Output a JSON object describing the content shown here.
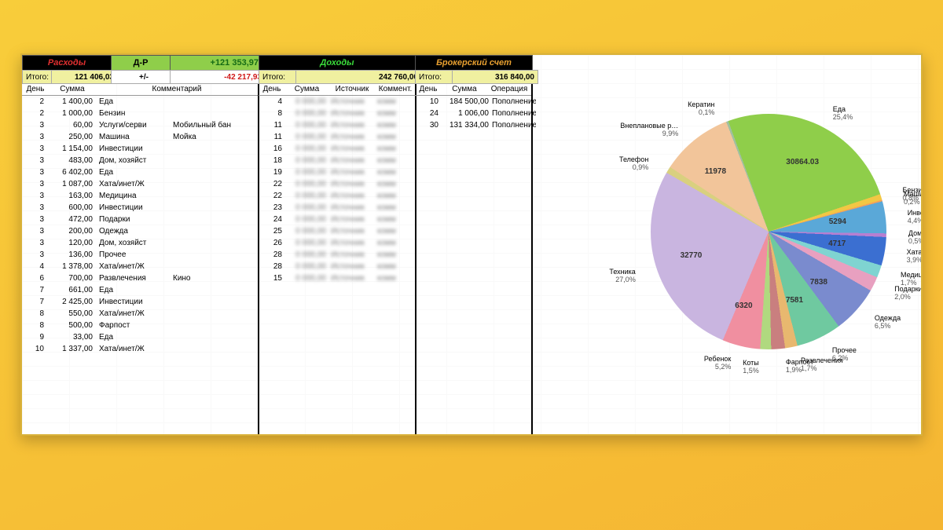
{
  "headers": {
    "expenses": "Расходы",
    "diff": "Д-Р",
    "diff_value": "+121 353,97",
    "pm": "+/-",
    "pm_value": "-42 217,93",
    "income": "Доходы",
    "broker": "Брокерский счет",
    "total_lbl": "Итого:",
    "expenses_total": "121 406,03",
    "income_total": "242 760,00",
    "broker_total": "316 840,00"
  },
  "cols": {
    "day": "День",
    "sum": "Сумма",
    "comment": "Комментарий",
    "source": "Источник",
    "op": "Операция",
    "komm": "Коммент."
  },
  "expenses_rows": [
    {
      "d": "2",
      "s": "1 400,00",
      "c": "Еда"
    },
    {
      "d": "2",
      "s": "1 000,00",
      "c": "Бензин"
    },
    {
      "d": "3",
      "s": "60,00",
      "c": "Услуги/серви",
      "c2": "Мобильный бан"
    },
    {
      "d": "3",
      "s": "250,00",
      "c": "Машина",
      "c2": "Мойка"
    },
    {
      "d": "3",
      "s": "1 154,00",
      "c": "Инвестиции"
    },
    {
      "d": "3",
      "s": "483,00",
      "c": "Дом, хозяйст"
    },
    {
      "d": "3",
      "s": "6 402,00",
      "c": "Еда"
    },
    {
      "d": "3",
      "s": "1 087,00",
      "c": "Хата/инет/Ж"
    },
    {
      "d": "3",
      "s": "163,00",
      "c": "Медицина"
    },
    {
      "d": "3",
      "s": "600,00",
      "c": "Инвестиции"
    },
    {
      "d": "3",
      "s": "472,00",
      "c": "Подарки"
    },
    {
      "d": "3",
      "s": "200,00",
      "c": "Одежда"
    },
    {
      "d": "3",
      "s": "120,00",
      "c": "Дом, хозяйст"
    },
    {
      "d": "3",
      "s": "136,00",
      "c": "Прочее"
    },
    {
      "d": "4",
      "s": "1 378,00",
      "c": "Хата/инет/Ж"
    },
    {
      "d": "6",
      "s": "700,00",
      "c": "Развлечения",
      "c2": "Кино"
    },
    {
      "d": "7",
      "s": "661,00",
      "c": "Еда"
    },
    {
      "d": "7",
      "s": "2 425,00",
      "c": "Инвестиции"
    },
    {
      "d": "8",
      "s": "550,00",
      "c": "Хата/инет/Ж"
    },
    {
      "d": "8",
      "s": "500,00",
      "c": "Фарпост"
    },
    {
      "d": "9",
      "s": "33,00",
      "c": "Еда"
    },
    {
      "d": "10",
      "s": "1 337,00",
      "c": "Хата/инет/Ж"
    }
  ],
  "income_rows": [
    {
      "d": "4"
    },
    {
      "d": "8"
    },
    {
      "d": "11"
    },
    {
      "d": "11"
    },
    {
      "d": "16"
    },
    {
      "d": "18"
    },
    {
      "d": "19"
    },
    {
      "d": "22"
    },
    {
      "d": "22"
    },
    {
      "d": "23"
    },
    {
      "d": "24"
    },
    {
      "d": "25"
    },
    {
      "d": "26"
    },
    {
      "d": "28"
    },
    {
      "d": "28"
    },
    {
      "d": "15"
    }
  ],
  "broker_rows": [
    {
      "d": "10",
      "s": "184 500,00",
      "op": "Пополнение"
    },
    {
      "d": "24",
      "s": "1 006,00",
      "op": "Пополнение"
    },
    {
      "d": "30",
      "s": "131 334,00",
      "op": "Пополнение"
    }
  ],
  "chart_data": {
    "type": "pie",
    "title": "",
    "slices": [
      {
        "name": "Еда",
        "pct": 25.4,
        "value": 30864.03,
        "color": "#8fce4a"
      },
      {
        "name": "Бензин",
        "pct": 0.8,
        "color": "#f2c744"
      },
      {
        "name": "Машина",
        "pct": 0.2,
        "color": "#f5a15a"
      },
      {
        "name": "Инвестиции",
        "pct": 4.4,
        "value": 5294,
        "color": "#5aa8d8"
      },
      {
        "name": "Дом, хозяйство",
        "pct": 0.5,
        "color": "#b77fd1"
      },
      {
        "name": "Хата/инет/ЖКХ",
        "pct": 3.9,
        "value": 4717,
        "color": "#3b6fd1"
      },
      {
        "name": "Медицина",
        "pct": 1.7,
        "color": "#7fd4d1"
      },
      {
        "name": "Подарки",
        "pct": 2.0,
        "color": "#e8a0c0"
      },
      {
        "name": "Одежда",
        "pct": 6.5,
        "value": 7838,
        "color": "#7a8bce"
      },
      {
        "name": "Прочее",
        "pct": 6.2,
        "value": 7581,
        "color": "#6fc9a0"
      },
      {
        "name": "Развлечения",
        "pct": 1.7,
        "color": "#e8b86f"
      },
      {
        "name": "Фарпост",
        "pct": 1.9,
        "color": "#c97f7f"
      },
      {
        "name": "Коты",
        "pct": 1.5,
        "color": "#b0d97f"
      },
      {
        "name": "Ребенок",
        "pct": 5.2,
        "value": 6320,
        "color": "#f08fa0"
      },
      {
        "name": "Техника",
        "pct": 27.0,
        "value": 32770,
        "color": "#c9b5e0"
      },
      {
        "name": "Телефон",
        "pct": 0.9,
        "color": "#d9d07f"
      },
      {
        "name": "Внеплановые р…",
        "pct": 9.9,
        "value": 11978,
        "color": "#f2c59a"
      },
      {
        "name": "Кератин",
        "pct": 0.1,
        "color": "#a0c0a0"
      }
    ]
  }
}
